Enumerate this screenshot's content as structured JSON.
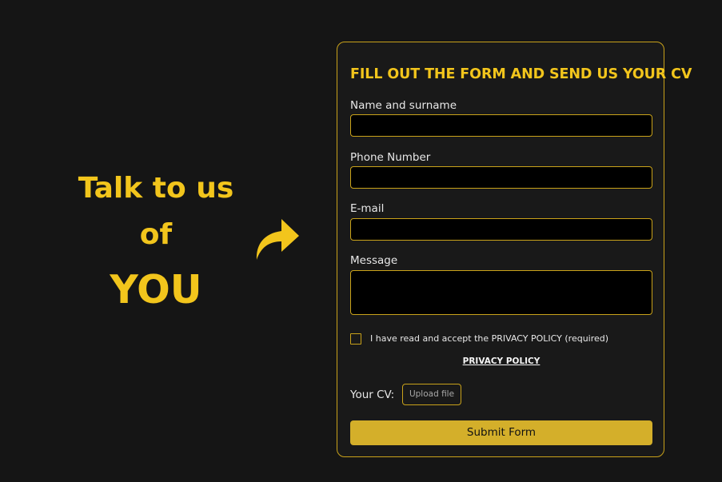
{
  "tagline": {
    "line1": "Talk to us",
    "line2": "of",
    "line3": "YOU"
  },
  "arrow_icon": "share-arrow-icon",
  "form": {
    "title": "FILL OUT THE FORM AND SEND US YOUR CV",
    "fields": [
      {
        "label": "Name and surname",
        "value": "",
        "placeholder": ""
      },
      {
        "label": "Phone Number",
        "value": "",
        "placeholder": ""
      },
      {
        "label": "E-mail",
        "value": "",
        "placeholder": ""
      },
      {
        "label": "Message",
        "value": "",
        "placeholder": ""
      }
    ],
    "checkbox_label": "I have read and accept the PRIVACY POLICY (required)",
    "checkbox_checked": false,
    "privacy_link": "PRIVACY POLICY",
    "cv_label": "Your CV:",
    "upload_label": "Upload file",
    "submit_label": "Submit Form"
  },
  "colors": {
    "background": "#151515",
    "accent": "#f2c51c",
    "submit_bg": "#d4af2a",
    "border": "#c9a21a"
  }
}
